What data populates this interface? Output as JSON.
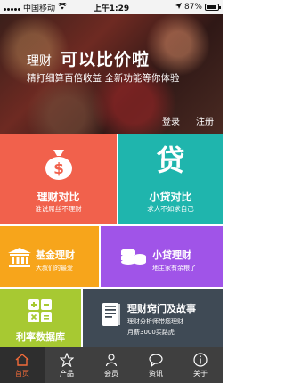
{
  "status_bar": {
    "carrier": "中国移动",
    "network": "",
    "time": "上午1:29",
    "battery_percent": "87%",
    "battery_level": 0.87
  },
  "banner": {
    "title_small": "理财",
    "title_big": "可以比价啦",
    "subtitle": "精打细算百倍收益 全新功能等你体验",
    "login": "登录",
    "register": "注册"
  },
  "tiles": {
    "licai": {
      "title": "理财对比",
      "sub": "谁说屌丝不理财",
      "color": "#f1614c",
      "icon": "money-bag-icon"
    },
    "xiaodai": {
      "title": "小贷对比",
      "sub": "求人不如求自己",
      "icon_char": "贷",
      "color": "#1fb5ad"
    },
    "jijin": {
      "title": "基金理财",
      "sub": "大叔们的最爱",
      "color": "#f7a51b",
      "icon": "bank-icon"
    },
    "xiaogou": {
      "title": "小贷理财",
      "sub": "地主家有余粮了",
      "color": "#a054e8",
      "icon": "coins-icon"
    },
    "lilv": {
      "title": "利率数据库",
      "color": "#a7c932",
      "icon": "calculator-icon"
    },
    "story": {
      "title": "理财窍门及故事",
      "sub_line1": "理财分析师带您理财",
      "sub_line2": "月薪3000买路虎",
      "color": "#3f4a55",
      "icon": "book-icon"
    }
  },
  "tabbar": {
    "items": [
      {
        "label": "首页",
        "icon": "home-icon",
        "active": true
      },
      {
        "label": "产品",
        "icon": "star-icon",
        "active": false
      },
      {
        "label": "会员",
        "icon": "user-icon",
        "active": false
      },
      {
        "label": "资讯",
        "icon": "chat-icon",
        "active": false
      },
      {
        "label": "关于",
        "icon": "info-icon",
        "active": false
      }
    ],
    "active_color": "#f26b3a"
  }
}
